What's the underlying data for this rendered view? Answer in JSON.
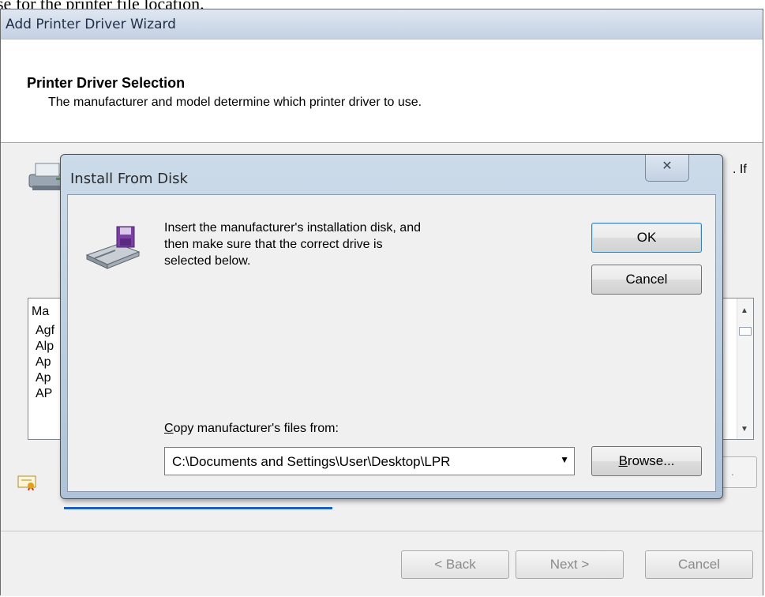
{
  "caption": "se for the printer file location.",
  "wizard": {
    "title": "Add Printer Driver Wizard",
    "header_title": "Printer Driver Selection",
    "header_subtitle": "The manufacturer and model determine which printer driver to use.",
    "bg_text_if": ". If",
    "list_header": "Ma",
    "list_items": [
      "Agf",
      "Alp",
      "Ap",
      "Ap",
      "AP"
    ],
    "partial_button": ".",
    "footer": {
      "back_label": "< Back",
      "next_label": "Next >",
      "cancel_label": "Cancel"
    }
  },
  "dialog": {
    "title": "Install From Disk",
    "close_glyph": "✕",
    "message": "Insert the manufacturer's installation disk, and then make sure that the correct drive is selected below.",
    "ok_label": "OK",
    "cancel_label": "Cancel",
    "copy_label_prefix": "C",
    "copy_label_rest": "opy manufacturer's files from:",
    "path_value": "C:\\Documents and Settings\\User\\Desktop\\LPR",
    "browse_prefix": "B",
    "browse_rest": "rowse..."
  },
  "icons": {
    "printer": "printer-icon",
    "disk": "floppy-disk-drive-icon",
    "certificate": "certificate-icon",
    "dropdown": "chevron-down-icon",
    "scroll_up": "scroll-up-icon",
    "scroll_down": "scroll-down-icon"
  },
  "colors": {
    "dialog_frame": "#b9cce0",
    "client_bg": "#f0f0f0",
    "default_button_border": "#3c7fb1",
    "link_blue": "#1b60c0"
  }
}
